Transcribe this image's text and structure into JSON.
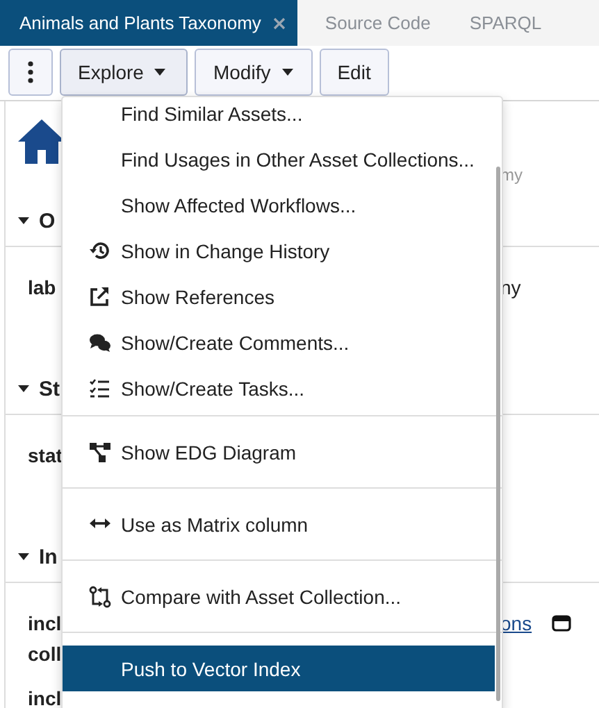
{
  "tabs": [
    {
      "label": "Animals and Plants Taxonomy",
      "selected": true,
      "closable": true
    },
    {
      "label": "Source Code",
      "selected": false,
      "closable": false
    },
    {
      "label": "SPARQL",
      "selected": false,
      "closable": false
    }
  ],
  "toolbar": {
    "buttons": [
      {
        "kind": "kebab",
        "selected": false
      },
      {
        "kind": "dropdown",
        "label": "Explore",
        "selected": true
      },
      {
        "kind": "dropdown",
        "label": "Modify",
        "selected": false
      },
      {
        "kind": "plain",
        "label": "Edit",
        "selected": false
      }
    ]
  },
  "page": {
    "header_text": "my",
    "sections": [
      {
        "label": "O",
        "expanded": true,
        "fields": [
          {
            "label": [
              "lab"
            ],
            "value": "ny"
          }
        ]
      },
      {
        "label": "St",
        "expanded": true,
        "fields": [
          {
            "label": [
              "stat"
            ]
          }
        ]
      },
      {
        "label": "In",
        "expanded": true,
        "fields": [
          {
            "label": [
              "incl",
              "coll"
            ],
            "link": "ons"
          },
          {
            "label": [
              "incl"
            ]
          }
        ]
      }
    ]
  },
  "menu": {
    "groups": [
      {
        "items": [
          {
            "label": "Find Similar Assets...",
            "kind": "plain",
            "selected": false
          },
          {
            "label": "Find Usages in Other Asset Collections...",
            "kind": "plain",
            "selected": false
          },
          {
            "label": "Show Affected Workflows...",
            "kind": "plain",
            "selected": false
          },
          {
            "label": "Show in Change History",
            "kind": "history",
            "selected": false
          },
          {
            "label": "Show References",
            "kind": "references",
            "selected": false
          },
          {
            "label": "Show/Create Comments...",
            "kind": "comments",
            "selected": false
          },
          {
            "label": "Show/Create Tasks...",
            "kind": "tasks",
            "selected": false
          }
        ]
      },
      {
        "items": [
          {
            "label": "Show EDG Diagram",
            "kind": "diagram",
            "selected": false
          }
        ]
      },
      {
        "items": [
          {
            "label": "Use as Matrix column",
            "kind": "matrix",
            "selected": false
          }
        ]
      },
      {
        "items": [
          {
            "label": "Compare with Asset Collection...",
            "kind": "compare",
            "selected": false
          }
        ]
      },
      {
        "items": [
          {
            "label": "Push to Vector Index",
            "kind": "plain",
            "selected": true
          }
        ]
      }
    ]
  }
}
